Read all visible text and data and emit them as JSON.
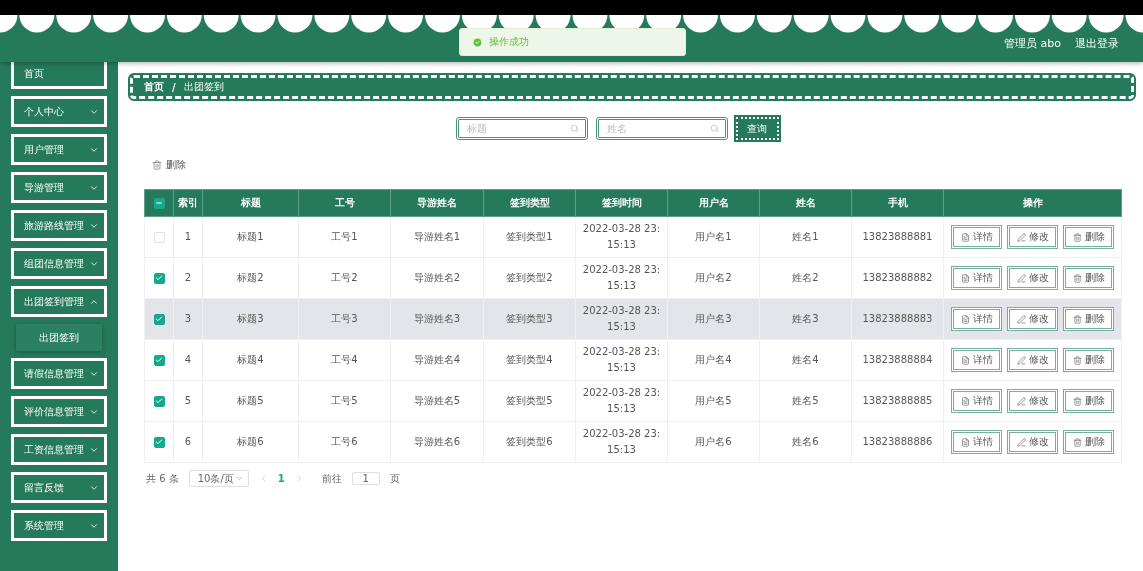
{
  "header": {
    "user_label": "管理员 abo",
    "logout": "退出登录"
  },
  "toast": {
    "kind": "success",
    "message": "操作成功"
  },
  "sidebar": {
    "items": [
      {
        "kind": "link",
        "label": "首页"
      },
      {
        "kind": "menu",
        "label": "个人中心",
        "expanded": false
      },
      {
        "kind": "menu",
        "label": "用户管理",
        "expanded": false
      },
      {
        "kind": "menu",
        "label": "导游管理",
        "expanded": false
      },
      {
        "kind": "menu",
        "label": "旅游路线管理",
        "expanded": false
      },
      {
        "kind": "menu",
        "label": "组团信息管理",
        "expanded": false
      },
      {
        "kind": "menu",
        "label": "出团签到管理",
        "expanded": true,
        "children": [
          {
            "label": "出团签到",
            "selected": true
          }
        ]
      },
      {
        "kind": "menu",
        "label": "请假信息管理",
        "expanded": false
      },
      {
        "kind": "menu",
        "label": "评价信息管理",
        "expanded": false
      },
      {
        "kind": "menu",
        "label": "工资信息管理",
        "expanded": false
      },
      {
        "kind": "menu",
        "label": "留言反馈",
        "expanded": false
      },
      {
        "kind": "menu",
        "label": "系统管理",
        "expanded": false
      }
    ]
  },
  "breadcrumb": {
    "items": [
      "首页",
      "出团签到"
    ],
    "separator": "/"
  },
  "search": {
    "fields": [
      {
        "placeholder": "标题"
      },
      {
        "placeholder": "姓名"
      }
    ],
    "button": "查询"
  },
  "toolbar": {
    "delete": "删除"
  },
  "table": {
    "header_checkbox": {
      "indeterminate": true
    },
    "columns": [
      "索引",
      "标题",
      "工号",
      "导游姓名",
      "签到类型",
      "签到时间",
      "用户名",
      "姓名",
      "手机",
      "操作"
    ],
    "rows": [
      {
        "checked": false,
        "hovered": false,
        "cells": [
          "1",
          "标题1",
          "工号1",
          "导游姓名1",
          "签到类型1",
          "2022-03-28 23:15:13",
          "用户名1",
          "姓名1",
          "13823888881"
        ],
        "actions": [
          "详情",
          "修改",
          "删除"
        ]
      },
      {
        "checked": true,
        "hovered": false,
        "cells": [
          "2",
          "标题2",
          "工号2",
          "导游姓名2",
          "签到类型2",
          "2022-03-28 23:15:13",
          "用户名2",
          "姓名2",
          "13823888882"
        ],
        "actions": [
          "详情",
          "修改",
          "删除"
        ]
      },
      {
        "checked": true,
        "hovered": true,
        "cells": [
          "3",
          "标题3",
          "工号3",
          "导游姓名3",
          "签到类型3",
          "2022-03-28 23:15:13",
          "用户名3",
          "姓名3",
          "13823888883"
        ],
        "actions": [
          "详情",
          "修改",
          "删除"
        ]
      },
      {
        "checked": true,
        "hovered": false,
        "cells": [
          "4",
          "标题4",
          "工号4",
          "导游姓名4",
          "签到类型4",
          "2022-03-28 23:15:13",
          "用户名4",
          "姓名4",
          "13823888884"
        ],
        "actions": [
          "详情",
          "修改",
          "删除"
        ]
      },
      {
        "checked": true,
        "hovered": false,
        "cells": [
          "5",
          "标题5",
          "工号5",
          "导游姓名5",
          "签到类型5",
          "2022-03-28 23:15:13",
          "用户名5",
          "姓名5",
          "13823888885"
        ],
        "actions": [
          "详情",
          "修改",
          "删除"
        ]
      },
      {
        "checked": true,
        "hovered": false,
        "cells": [
          "6",
          "标题6",
          "工号6",
          "导游姓名6",
          "签到类型6",
          "2022-03-28 23:15:13",
          "用户名6",
          "姓名6",
          "13823888886"
        ],
        "actions": [
          "详情",
          "修改",
          "删除"
        ]
      }
    ]
  },
  "pagination": {
    "total": "共 6 条",
    "page_size": "10条/页",
    "pages": [
      {
        "label": "1",
        "selected": true
      }
    ],
    "goto_label": "前往",
    "goto_value": "1",
    "page_suffix": "页"
  }
}
